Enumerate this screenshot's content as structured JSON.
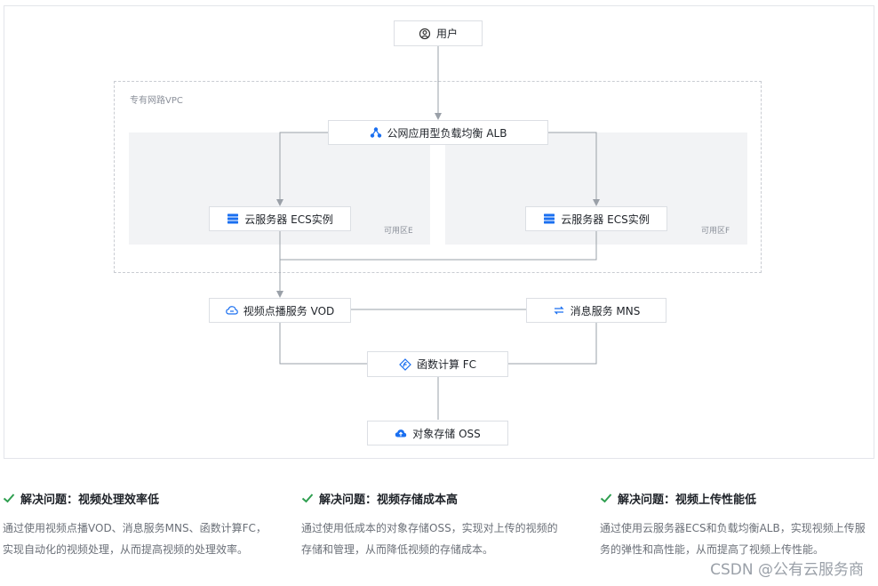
{
  "diagram": {
    "nodes": {
      "user": {
        "label": "用户",
        "icon": "user-icon"
      },
      "alb": {
        "label": "公网应用型负载均衡 ALB",
        "icon": "load-balancer-icon"
      },
      "ecs_e": {
        "label": "云服务器 ECS实例",
        "icon": "server-icon"
      },
      "ecs_f": {
        "label": "云服务器 ECS实例",
        "icon": "server-icon"
      },
      "vod": {
        "label": "视频点播服务 VOD",
        "icon": "cloud-link-icon"
      },
      "mns": {
        "label": "消息服务 MNS",
        "icon": "sync-icon"
      },
      "fc": {
        "label": "函数计算 FC",
        "icon": "function-icon"
      },
      "oss": {
        "label": "对象存储 OSS",
        "icon": "cloud-upload-icon"
      }
    },
    "vpc_label": "专有网路VPC",
    "zone_e_label": "可用区E",
    "zone_f_label": "可用区F"
  },
  "benefits": [
    {
      "title": "解决问题：视频处理效率低",
      "desc": "通过使用视频点播VOD、消息服务MNS、函数计算FC，实现自动化的视频处理，从而提高视频的处理效率。"
    },
    {
      "title": "解决问题：视频存储成本高",
      "desc": "通过使用低成本的对象存储OSS，实现对上传的视频的存储和管理，从而降低视频的存储成本。"
    },
    {
      "title": "解决问题：视频上传性能低",
      "desc": "通过使用云服务器ECS和负载均衡ALB，实现视频上传服务的弹性和高性能，从而提高了视频上传性能。"
    }
  ],
  "watermark": "CSDN @公有云服务商",
  "colors": {
    "accent": "#1a6ff0",
    "check": "#2e9e4f",
    "line": "#9aa0a8"
  }
}
